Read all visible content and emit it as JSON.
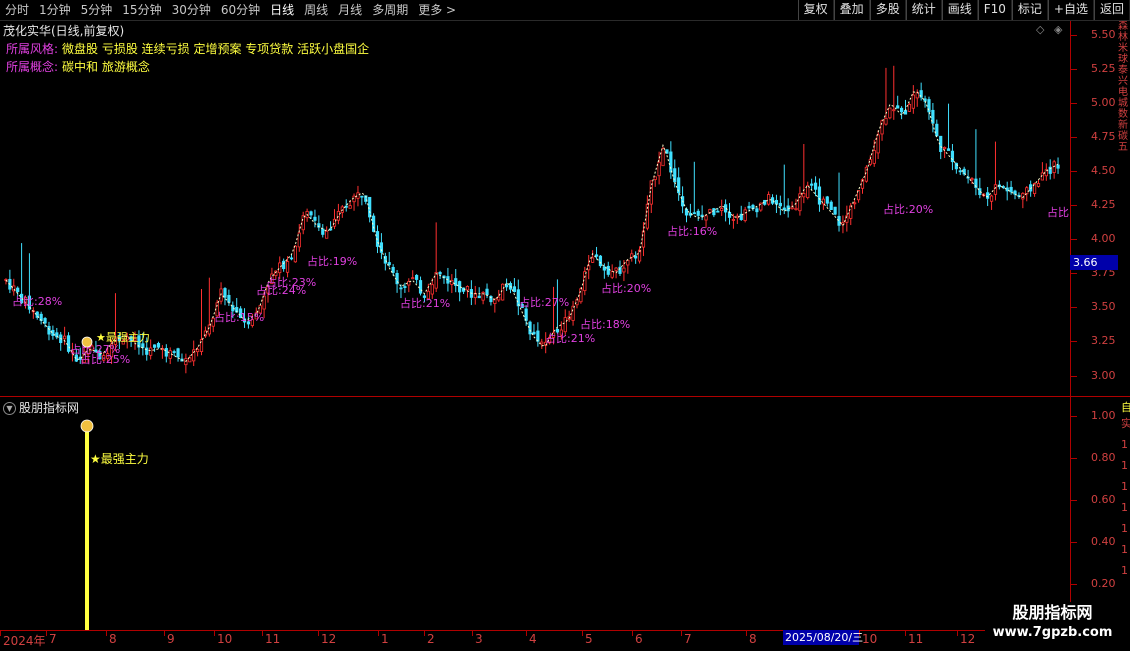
{
  "toolbar": {
    "periods": [
      "分时",
      "1分钟",
      "5分钟",
      "15分钟",
      "30分钟",
      "60分钟",
      "日线",
      "周线",
      "月线",
      "多周期",
      "更多 >"
    ],
    "active_period": "日线",
    "buttons": [
      "复权",
      "叠加",
      "多股",
      "统计",
      "画线",
      "F10",
      "标记",
      "+自选",
      "返回"
    ]
  },
  "main": {
    "stock_title": "茂化实华(日线,前复权)",
    "style_label": "所属风格:",
    "style_value": "微盘股 亏损股 连续亏损 定增预案 专项贷款 活跃小盘国企",
    "concept_label": "所属概念:",
    "concept_value": "碳中和 旅游概念",
    "current_price": "3.66",
    "price_ticks": [
      "5.50",
      "5.25",
      "5.00",
      "4.75",
      "4.50",
      "4.25",
      "4.00",
      "3.75",
      "3.50",
      "3.25",
      "3.00"
    ],
    "right_strip_text": "森林米球泰兴电城数新碳五",
    "annotations": [
      {
        "text": "占比:28%",
        "color": "#e040e0"
      },
      {
        "text": "占比:27%",
        "color": "#e040e0"
      },
      {
        "text": "占比:25%",
        "color": "#e040e0"
      },
      {
        "text": "★最强主力",
        "color": "#ffff40"
      },
      {
        "text": "占比:15%",
        "color": "#e040e0"
      },
      {
        "text": "占比:24%",
        "color": "#e040e0"
      },
      {
        "text": "占比:23%",
        "color": "#e040e0"
      },
      {
        "text": "占比:19%",
        "color": "#e040e0"
      },
      {
        "text": "占比:21%",
        "color": "#e040e0"
      },
      {
        "text": "占比:27%",
        "color": "#e040e0"
      },
      {
        "text": "占比:21%",
        "color": "#e040e0"
      },
      {
        "text": "占比:18%",
        "color": "#e040e0"
      },
      {
        "text": "占比:20%",
        "color": "#e040e0"
      },
      {
        "text": "占比:16%",
        "color": "#e040e0"
      },
      {
        "text": "占比:20%",
        "color": "#e040e0"
      },
      {
        "text": "占比",
        "color": "#e040e0"
      }
    ]
  },
  "sub": {
    "title": "股朋指标网",
    "signal_label": "★最强主力",
    "ticks": [
      "1.00",
      "0.80",
      "0.60",
      "0.40",
      "0.20"
    ],
    "right_top": "自",
    "right_chars": "实1111111"
  },
  "date_axis": {
    "labels": [
      "2024年",
      "7",
      "8",
      "9",
      "10",
      "11",
      "12",
      "1",
      "2",
      "3",
      "4",
      "5",
      "6",
      "7",
      "8",
      "9",
      "10",
      "11",
      "12"
    ],
    "crosshair": "2025/08/20/三"
  },
  "watermark": {
    "name": "股朋指标网",
    "url": "www.7gpzb.com"
  },
  "colors": {
    "up": "#ff3030",
    "down": "#40e0ff",
    "accent_magenta": "#e040e0",
    "accent_yellow": "#ffff40",
    "axis_red": "#b00000"
  },
  "chart_data": {
    "type": "candlestick",
    "title": "茂化实华(日线,前复权)",
    "ylim": [
      2.85,
      5.6
    ],
    "x_labels": [
      "2024年",
      "7",
      "8",
      "9",
      "10",
      "11",
      "12",
      "1",
      "2",
      "3",
      "4",
      "5",
      "6",
      "7",
      "8",
      "9",
      "10",
      "11",
      "12"
    ],
    "y_ticks": [
      3.0,
      3.25,
      3.5,
      3.75,
      4.0,
      4.25,
      4.5,
      4.75,
      5.0,
      5.25,
      5.5
    ],
    "close_path": [
      3.7,
      3.6,
      3.5,
      3.4,
      3.3,
      3.25,
      3.1,
      3.2,
      3.15,
      3.25,
      3.3,
      3.22,
      3.18,
      3.2,
      3.15,
      3.1,
      3.2,
      3.35,
      3.6,
      3.5,
      3.4,
      3.45,
      3.7,
      3.8,
      3.9,
      4.2,
      4.1,
      4.05,
      4.2,
      4.3,
      4.35,
      4.0,
      3.8,
      3.65,
      3.7,
      3.6,
      3.75,
      3.7,
      3.65,
      3.6,
      3.6,
      3.55,
      3.7,
      3.5,
      3.3,
      3.2,
      3.35,
      3.4,
      3.6,
      3.9,
      3.8,
      3.75,
      3.85,
      3.9,
      4.4,
      4.7,
      4.4,
      4.2,
      4.15,
      4.2,
      4.25,
      4.15,
      4.2,
      4.25,
      4.3,
      4.2,
      4.25,
      4.4,
      4.3,
      4.2,
      4.1,
      4.3,
      4.5,
      4.8,
      5.0,
      4.9,
      5.1,
      5.0,
      4.7,
      4.6,
      4.5,
      4.4,
      4.3,
      4.4,
      4.35,
      4.3,
      4.4,
      4.5,
      4.55
    ]
  }
}
